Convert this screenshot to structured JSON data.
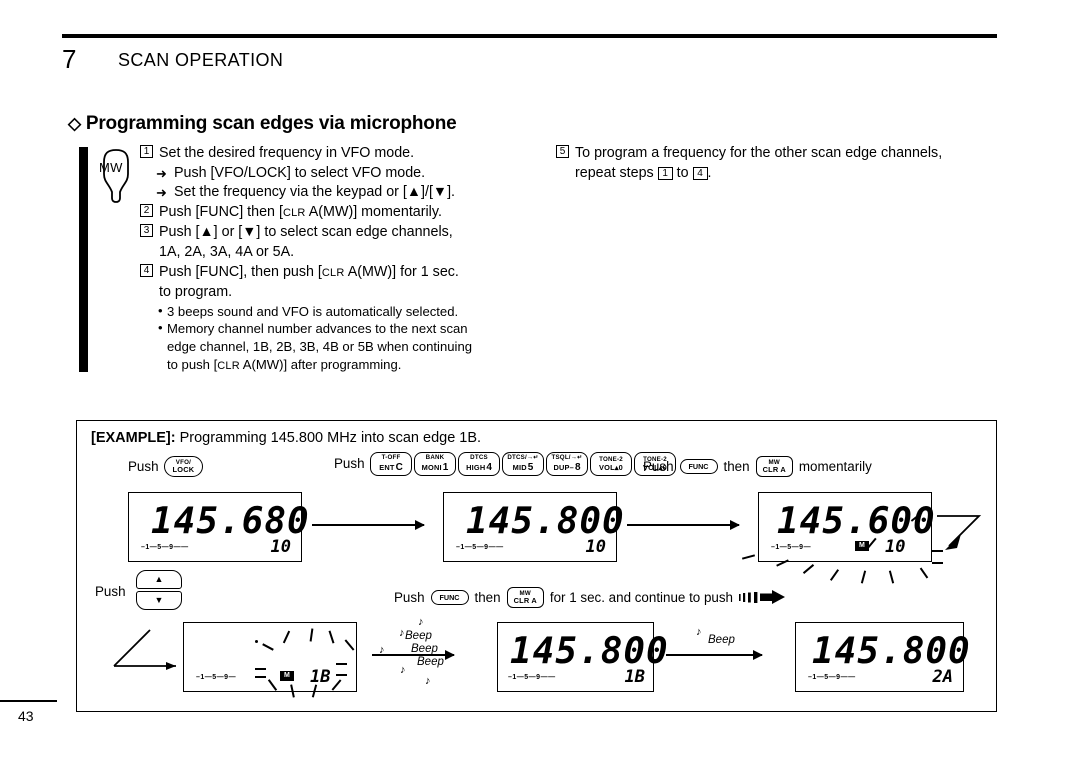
{
  "page": {
    "chapter_number": "7",
    "chapter_title": "SCAN OPERATION",
    "page_number": "43"
  },
  "section": {
    "diamond": "◇",
    "heading": "Programming scan edges via microphone"
  },
  "mic": {
    "label": "MW"
  },
  "steps_left": [
    {
      "num": "1",
      "text": "Set the desired frequency in VFO mode."
    },
    {
      "arrow": "➜",
      "text": "Push [VFO/LOCK] to select VFO mode."
    },
    {
      "arrow": "➜",
      "text": "Set the frequency via the keypad or [▲]/[▼]."
    },
    {
      "num": "2",
      "text_a": "Push [FUNC] then [",
      "sc": "CLR",
      "text_b": " A(MW)] momentarily."
    },
    {
      "num": "3",
      "text": "Push [▲] or [▼] to select scan edge channels,",
      "cont": "1A, 2A, 3A, 4A or 5A."
    },
    {
      "num": "4",
      "text_a": "Push [FUNC], then push [",
      "sc": "CLR",
      "text_b": " A(MW)] for 1 sec.",
      "cont": "to program."
    }
  ],
  "bullets": [
    {
      "dot": "•",
      "text": "3 beeps sound and VFO is automatically selected."
    },
    {
      "dot": "•",
      "text": "Memory channel number advances to the next scan",
      "cont1": "edge channel, 1B, 2B, 3B, 4B or 5B when continuing",
      "cont2_a": "to push [",
      "cont2_sc": "CLR",
      "cont2_b": " A(MW)] after programming."
    }
  ],
  "steps_right": {
    "num": "5",
    "line1": "To program a frequency for the other scan edge channels,",
    "line2_a": "repeat steps ",
    "line2_num1": "1",
    "line2_mid": " to ",
    "line2_num2": "4",
    "line2_b": "."
  },
  "example": {
    "label": "[EXAMPLE]:",
    "text": " Programming 145.800 MHz into scan edge 1B."
  },
  "push_labels": {
    "row1_push1": "Push",
    "row1_push2": "Push",
    "row1_push3": "Push",
    "row1_then3": "then",
    "row1_moment3": "momentarily",
    "row2_push1": "Push",
    "row2_push2": "Push",
    "row2_then2": "then",
    "row2_tail2": "for 1 sec. and continue to push"
  },
  "keys": {
    "vfo_lock": {
      "l1": "VFO/",
      "l2": "LOCK"
    },
    "func": {
      "label": "FUNC"
    },
    "mw_clr_a": {
      "l1": "MW",
      "l2": "CLR A"
    },
    "keypad": [
      {
        "l1": "T-OFF",
        "l2": "ENT",
        "big": "C"
      },
      {
        "l1": "BANK",
        "l2": "MONI",
        "big": "1"
      },
      {
        "l1": "DTCS",
        "l2": "HIGH",
        "big": "4"
      },
      {
        "l1": "DTCS/→↵",
        "l2": "MID",
        "big": "5"
      },
      {
        "l1": "TSQL/→↵",
        "l2": "DUP–",
        "big": "8"
      },
      {
        "l1": "TONE-2",
        "l2": "VOL▴0",
        "big": ""
      },
      {
        "l1": "TONE-2",
        "l2": "VOL▴0",
        "big": ""
      }
    ],
    "rocker_up": "▲",
    "rocker_down": "▼"
  },
  "displays": [
    {
      "id": "lcd-1",
      "frequency": "145.680",
      "channel": "10",
      "smeter": "–1—5—9——",
      "m_indicator": false,
      "blinking": false
    },
    {
      "id": "lcd-2",
      "frequency": "145.800",
      "channel": "10",
      "smeter": "–1—5—9——",
      "m_indicator": false,
      "blinking": false
    },
    {
      "id": "lcd-3",
      "frequency": "145.600",
      "channel": "10",
      "smeter": "–1—5—9—",
      "m_indicator": true,
      "m_label": "M",
      "blinking": true
    },
    {
      "id": "lcd-4",
      "frequency": "",
      "channel": "1B",
      "smeter": "–1—5—9—",
      "m_indicator": true,
      "m_label": "M",
      "blinking": true
    },
    {
      "id": "lcd-5",
      "frequency": "145.800",
      "channel": "1B",
      "smeter": "–1—5—9——",
      "m_indicator": false,
      "blinking": false
    },
    {
      "id": "lcd-6",
      "frequency": "145.800",
      "channel": "2A",
      "smeter": "–1—5—9——",
      "m_indicator": false,
      "blinking": false
    }
  ],
  "beeps": {
    "triple": {
      "l1": "Beep",
      "l2": "Beep",
      "l3": "Beep"
    },
    "single": "Beep",
    "note_glyph": "♪"
  },
  "colors": {
    "ink": "#000000",
    "paper": "#ffffff"
  }
}
